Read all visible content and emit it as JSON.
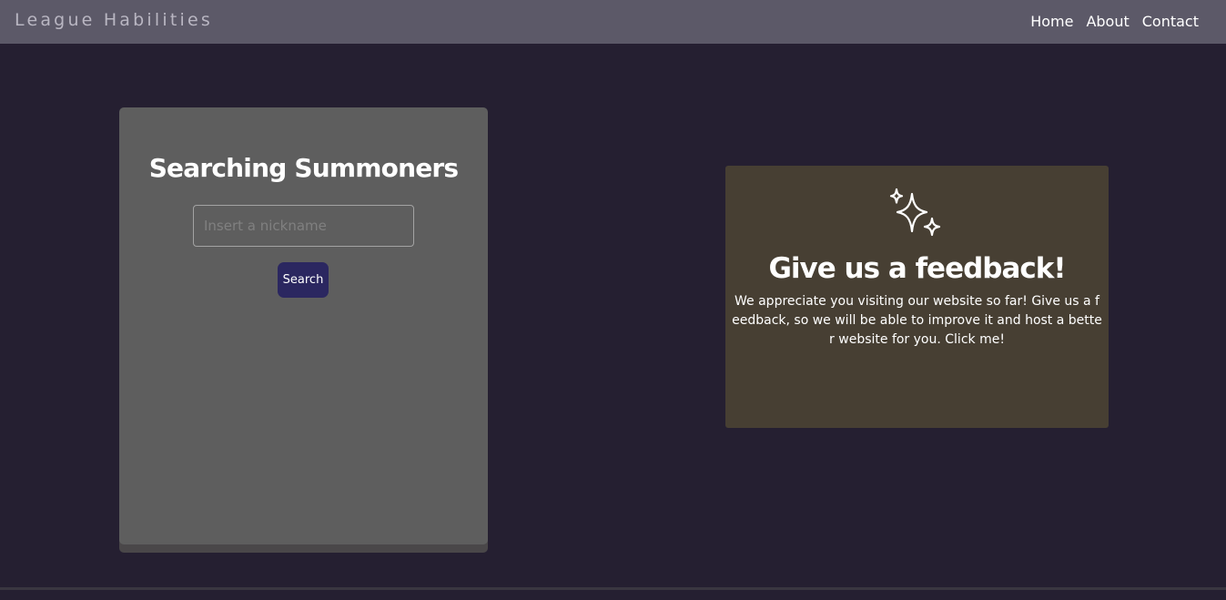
{
  "navbar": {
    "brand": "League Habilities",
    "links": [
      "Home",
      "About",
      "Contact"
    ]
  },
  "search": {
    "title": "Searching Summoners",
    "placeholder": "Insert a nickname",
    "value": "",
    "button_label": "Search"
  },
  "feedback": {
    "icon": "sparkles-icon",
    "title": "Give us a feedback!",
    "text": "We appreciate you visiting our website so far! Give us a feedback, so we will be able to improve it and host a better website for you. Click me!"
  },
  "colors": {
    "background": "#251f31",
    "navbar": "#5c5968",
    "search_card": "#5e5e5e",
    "search_button": "#2b2760",
    "feedback_card": "#473f33"
  }
}
